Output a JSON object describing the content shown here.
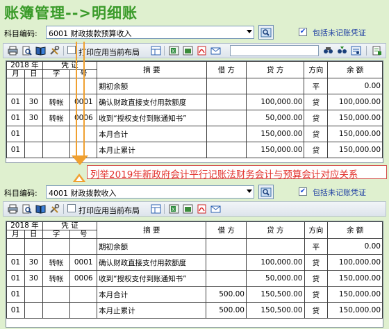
{
  "title": "账簿管理-->明细账",
  "subject_label": "科目编码:",
  "include_unposted_label": "包括未记账凭证",
  "print_layout_label": "打印应用当前布局",
  "annotation": "列举2019年新政府会计平行记账法财务会计与预算会计对应关系",
  "headers": {
    "year": "2018 年",
    "voucher": "凭 证",
    "month": "月",
    "day": "日",
    "word": "字",
    "number": "号",
    "summary": "摘 要",
    "debit": "借 方",
    "credit": "贷 方",
    "direction": "方向",
    "balance": "余 额"
  },
  "top_ledger": {
    "subject_value": "6001  财政拨款预算收入",
    "rows": [
      {
        "month": "",
        "day": "",
        "word": "",
        "no": "",
        "summary": "期初余额",
        "debit": "",
        "credit": "",
        "dir": "平",
        "balance": "0.00"
      },
      {
        "month": "01",
        "day": "30",
        "word": "转帐",
        "no": "0001",
        "summary": "确认财政直接支付用款额度",
        "debit": "",
        "credit": "100,000.00",
        "dir": "贷",
        "balance": "100,000.00"
      },
      {
        "month": "01",
        "day": "30",
        "word": "转帐",
        "no": "0006",
        "summary": "收到“授权支付到账通知书”",
        "debit": "",
        "credit": "50,000.00",
        "dir": "贷",
        "balance": "150,000.00"
      },
      {
        "month": "01",
        "day": "",
        "word": "",
        "no": "",
        "summary": "本月合计",
        "debit": "",
        "credit": "150,000.00",
        "dir": "贷",
        "balance": "150,000.00"
      },
      {
        "month": "01",
        "day": "",
        "word": "",
        "no": "",
        "summary": "本月止累计",
        "debit": "",
        "credit": "150,000.00",
        "dir": "贷",
        "balance": "150,000.00"
      }
    ]
  },
  "bottom_ledger": {
    "subject_value": "4001  财政拨款收入",
    "rows": [
      {
        "month": "",
        "day": "",
        "word": "",
        "no": "",
        "summary": "期初余额",
        "debit": "",
        "credit": "",
        "dir": "平",
        "balance": "0.00"
      },
      {
        "month": "01",
        "day": "30",
        "word": "转帐",
        "no": "0001",
        "summary": "确认财政直接支付用款额度",
        "debit": "",
        "credit": "100,000.00",
        "dir": "贷",
        "balance": "100,000.00"
      },
      {
        "month": "01",
        "day": "30",
        "word": "转帐",
        "no": "0006",
        "summary": "收到“授权支付到账通知书”",
        "debit": "",
        "credit": "50,000.00",
        "dir": "贷",
        "balance": "150,000.00"
      },
      {
        "month": "01",
        "day": "",
        "word": "",
        "no": "",
        "summary": "本月合计",
        "debit": "500.00",
        "credit": "150,500.00",
        "dir": "贷",
        "balance": "150,000.00"
      },
      {
        "month": "01",
        "day": "",
        "word": "",
        "no": "",
        "summary": "本月止累计",
        "debit": "500.00",
        "credit": "150,500.00",
        "dir": "贷",
        "balance": "150,000.00"
      }
    ]
  },
  "icons": [
    "print-icon",
    "preview-icon",
    "book-icon",
    "tools-icon",
    "layout-icon",
    "export-excel-icon",
    "export-pdf-icon",
    "email-icon",
    "find-icon",
    "find-next-icon",
    "filter-icon",
    "exit-icon",
    "search-icon"
  ],
  "colors": {
    "background": "#dff0cf",
    "title": "#3a9b2a",
    "annotation": "#e2322c",
    "arrow": "#f0a030"
  }
}
